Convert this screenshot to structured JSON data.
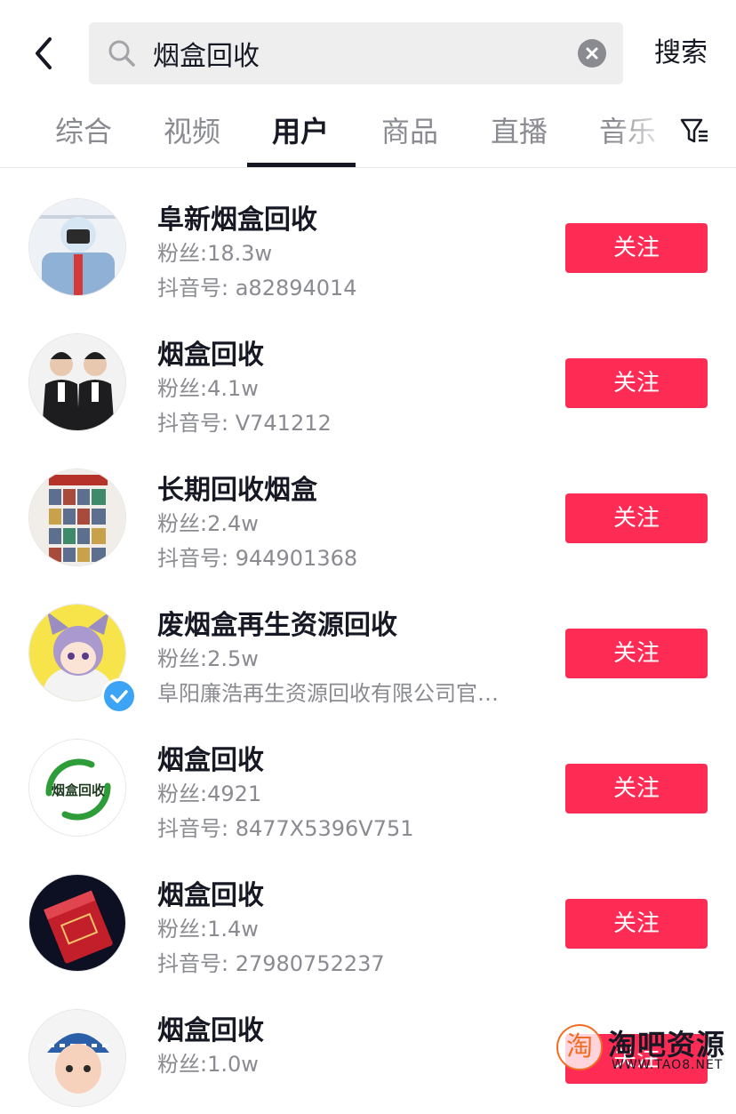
{
  "search": {
    "query": "烟盒回收",
    "submit_label": "搜索"
  },
  "tabs": [
    {
      "label": "综合",
      "active": false
    },
    {
      "label": "视频",
      "active": false
    },
    {
      "label": "用户",
      "active": true
    },
    {
      "label": "商品",
      "active": false
    },
    {
      "label": "直播",
      "active": false
    },
    {
      "label": "音乐",
      "active": false
    }
  ],
  "colors": {
    "accent": "#fe2c55",
    "verified": "#3ca3f5",
    "text_primary": "#161823",
    "text_secondary": "#8a8b91"
  },
  "users": [
    {
      "name": "阜新烟盒回收",
      "fans": "粉丝:18.3w",
      "sub": "抖音号: a82894014",
      "follow_label": "关注",
      "verified": false
    },
    {
      "name": "烟盒回收",
      "fans": "粉丝:4.1w",
      "sub": "抖音号: V741212",
      "follow_label": "关注",
      "verified": false
    },
    {
      "name": "长期回收烟盒",
      "fans": "粉丝:2.4w",
      "sub": "抖音号: 944901368",
      "follow_label": "关注",
      "verified": false
    },
    {
      "name": "废烟盒再生资源回收",
      "fans": "粉丝:2.5w",
      "sub": "阜阳廉浩再生资源回收有限公司官…",
      "follow_label": "关注",
      "verified": true
    },
    {
      "name": "烟盒回收",
      "fans": "粉丝:4921",
      "sub": "抖音号: 8477X5396V751",
      "follow_label": "关注",
      "verified": false
    },
    {
      "name": "烟盒回收",
      "fans": "粉丝:1.4w",
      "sub": "抖音号: 27980752237",
      "follow_label": "关注",
      "verified": false
    },
    {
      "name": "烟盒回收",
      "fans": "粉丝:1.0w",
      "sub": "",
      "follow_label": "关注",
      "verified": false
    }
  ],
  "avatar_logo_text": "烟盒回收",
  "watermark": {
    "logo_glyph": "淘",
    "title": "淘吧资源",
    "url": "WWW.TAO8.NET"
  }
}
